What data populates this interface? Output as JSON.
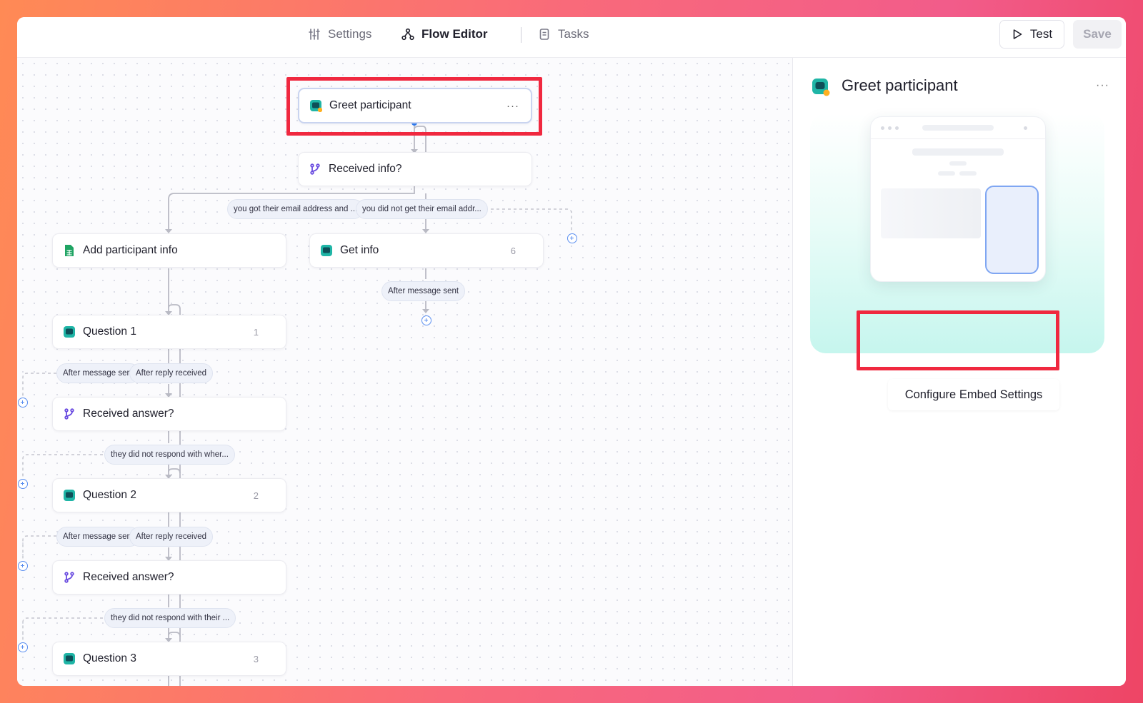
{
  "topbar": {
    "tabs": [
      {
        "label": "Settings",
        "icon": "sliders-icon",
        "active": false
      },
      {
        "label": "Flow Editor",
        "icon": "flow-icon",
        "active": true
      },
      {
        "label": "Tasks",
        "icon": "document-icon",
        "active": false
      }
    ],
    "test_label": "Test",
    "save_label": "Save"
  },
  "flow": {
    "nodes": [
      {
        "id": "greet",
        "label": "Greet participant",
        "icon": "chat-bot-icon",
        "selected": true
      },
      {
        "id": "received_info",
        "label": "Received info?",
        "icon": "branch-icon"
      },
      {
        "id": "add_info",
        "label": "Add participant info",
        "icon": "spreadsheet-icon"
      },
      {
        "id": "get_info",
        "label": "Get info",
        "icon": "chat-icon",
        "num": "6"
      },
      {
        "id": "q1",
        "label": "Question 1",
        "icon": "chat-icon",
        "num": "1"
      },
      {
        "id": "ra1",
        "label": "Received answer?",
        "icon": "branch-icon"
      },
      {
        "id": "q2",
        "label": "Question 2",
        "icon": "chat-icon",
        "num": "2"
      },
      {
        "id": "ra2",
        "label": "Received answer?",
        "icon": "branch-icon"
      },
      {
        "id": "q3",
        "label": "Question 3",
        "icon": "chat-icon",
        "num": "3"
      }
    ],
    "pills": [
      "you got their email address and ...",
      "you did not get their email addr...",
      "After message sent",
      "After message sent",
      "After reply received",
      "they did not respond with wher...",
      "After message sent",
      "After reply received",
      "they did not respond with their ..."
    ]
  },
  "panel": {
    "title": "Greet participant",
    "more": "···",
    "configure_label": "Configure Embed Settings"
  },
  "colors": {
    "accent_blue": "#5b8ff0",
    "highlight_red": "#f0283f",
    "teal_icon": "#1fb5a6"
  }
}
